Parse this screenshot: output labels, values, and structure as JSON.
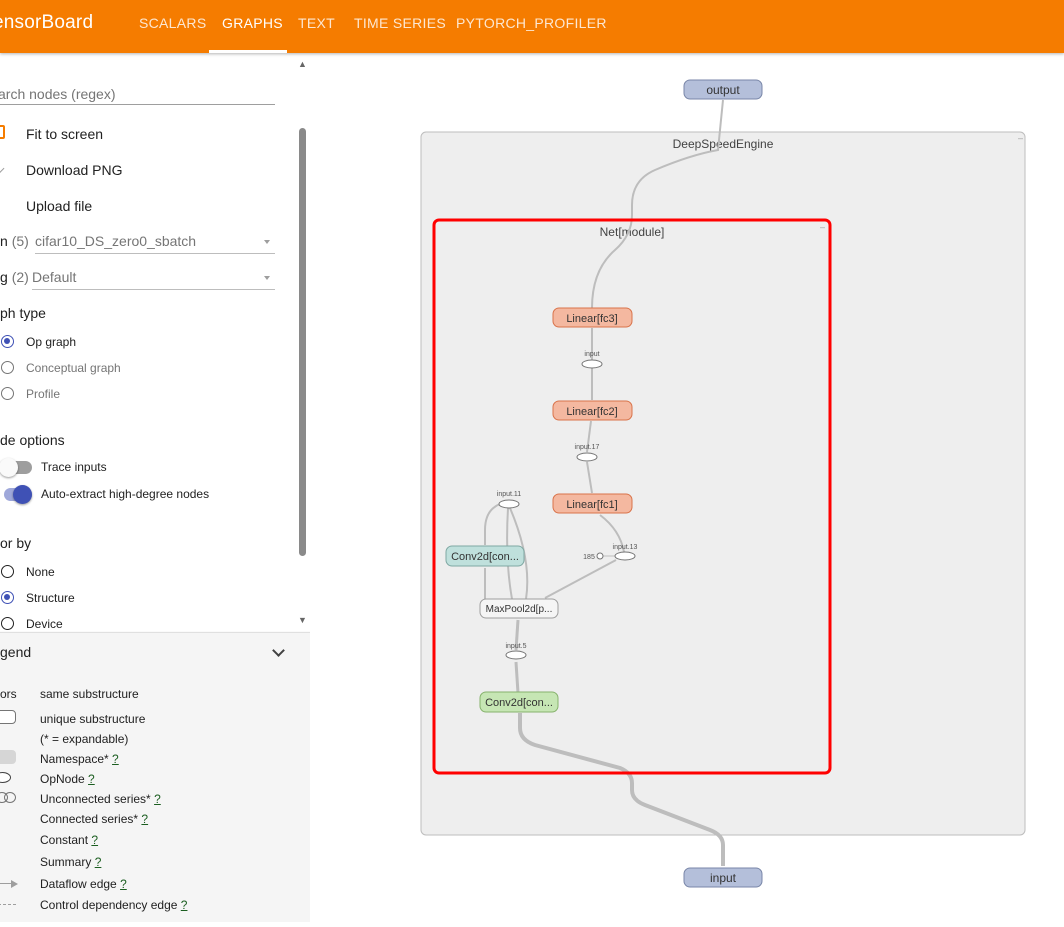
{
  "app": {
    "title": "ensorBoard"
  },
  "tabs": [
    {
      "label": "SCALARS"
    },
    {
      "label": "GRAPHS"
    },
    {
      "label": "TEXT"
    },
    {
      "label": "TIME SERIES"
    },
    {
      "label": "PYTORCH_PROFILER"
    }
  ],
  "active_tab": "GRAPHS",
  "sidebar": {
    "search": {
      "placeholder": "arch nodes (regex)"
    },
    "actions": [
      "Fit to screen",
      "Download PNG",
      "Upload file"
    ],
    "run": {
      "label": "n",
      "count": "(5)",
      "value": "cifar10_DS_zero0_sbatch"
    },
    "tag": {
      "label": "g",
      "count": "(2)",
      "value": "Default"
    },
    "graph_type": {
      "heading": "ph type",
      "options": [
        "Op graph",
        "Conceptual graph",
        "Profile"
      ],
      "selected": "Op graph"
    },
    "node_options": {
      "heading": "de options",
      "trace_inputs": {
        "label": "Trace inputs",
        "on": false
      },
      "auto_extract": {
        "label": "Auto-extract high-degree nodes",
        "on": true
      }
    },
    "color_by": {
      "heading": "or by",
      "options": [
        "None",
        "Structure",
        "Device"
      ],
      "selected": "Structure"
    },
    "legend": {
      "heading": "gend",
      "colors_label": "ors",
      "same_substructure": "same substructure",
      "unique_substructure": "unique substructure",
      "expandable_note": "(* = expandable)",
      "items": [
        {
          "label": "Namespace*",
          "help": "?"
        },
        {
          "label": "OpNode",
          "help": "?"
        },
        {
          "label": "Unconnected series*",
          "help": "?"
        },
        {
          "label": "Connected series*",
          "help": "?"
        },
        {
          "label": "Constant",
          "help": "?"
        },
        {
          "label": "Summary",
          "help": "?"
        },
        {
          "label": "Dataflow edge",
          "help": "?"
        },
        {
          "label": "Control dependency edge",
          "help": "?"
        }
      ]
    }
  },
  "graph": {
    "output_node": "output",
    "input_node": "input",
    "outer_scope": "DeepSpeedEngine",
    "inner_scope": "Net[module]",
    "nodes": {
      "fc3": "Linear[fc3]",
      "fc2": "Linear[fc2]",
      "fc1": "Linear[fc1]",
      "conv_a": "Conv2d[con...",
      "maxpool": "MaxPool2d[p...",
      "conv_b": "Conv2d[con..."
    },
    "op_labels": {
      "input": "input",
      "input17": "input.17",
      "input11": "input.11",
      "input13": "input.13",
      "input5": "input.5",
      "const185": "185"
    },
    "colors": {
      "linear_fill": "#f4b8a0",
      "linear_stroke": "#d9734a",
      "conv_a_fill": "#bfe0dc",
      "conv_b_fill": "#c6e6b4",
      "io_fill": "#b4bfda",
      "scope_fill": "#eeeeee",
      "highlight": "#ff0000"
    }
  }
}
